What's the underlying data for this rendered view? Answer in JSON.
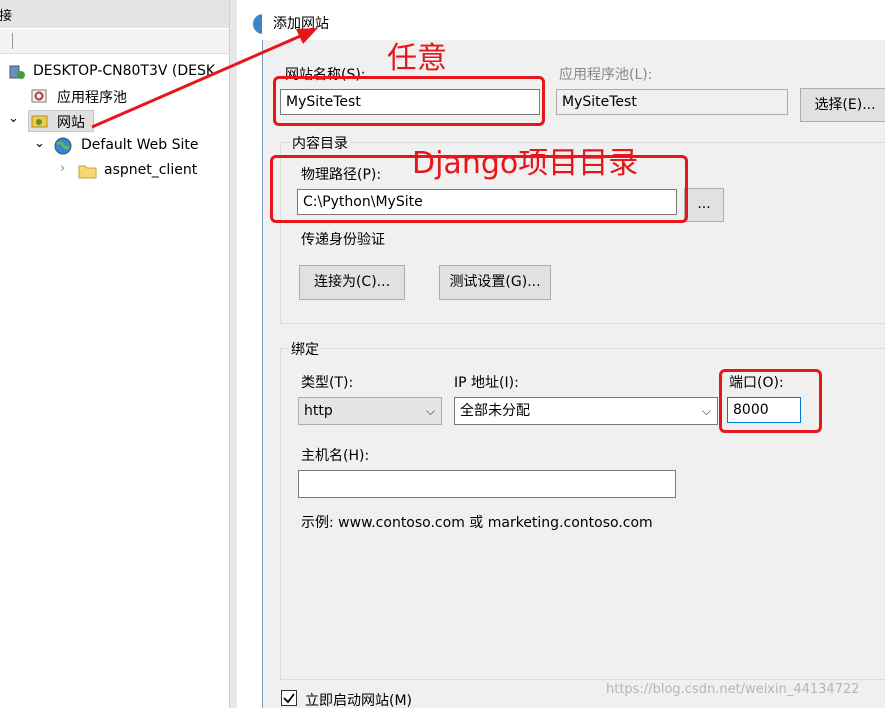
{
  "left_pane": {
    "header": "连接",
    "tree": [
      {
        "label": "DESKTOP-CN80T3V (DESK",
        "icon": "server-icon"
      },
      {
        "label": "应用程序池",
        "icon": "app-pool-icon"
      },
      {
        "label": "网站",
        "icon": "sites-folder-icon"
      },
      {
        "label": "Default Web Site",
        "icon": "globe-icon"
      },
      {
        "label": "aspnet_client",
        "icon": "folder-icon"
      }
    ]
  },
  "dialog": {
    "title": "添加网站",
    "site_name": {
      "label": "网站名称(S):",
      "value": "MySiteTest"
    },
    "app_pool": {
      "label": "应用程序池(L):",
      "value": "MySiteTest",
      "select_button": "选择(E)..."
    },
    "content_dir": {
      "group_label": "内容目录",
      "path_label": "物理路径(P):",
      "path_value": "C:\\Python\\MySite",
      "browse_button": "...",
      "auth_label": "传递身份验证",
      "connect_button": "连接为(C)...",
      "test_button": "测试设置(G)..."
    },
    "binding": {
      "group_label": "绑定",
      "type_label": "类型(T):",
      "type_value": "http",
      "ip_label": "IP 地址(I):",
      "ip_value": "全部未分配",
      "port_label": "端口(O):",
      "port_value": "8000",
      "host_label": "主机名(H):",
      "host_value": "",
      "example": "示例: www.contoso.com 或 marketing.contoso.com"
    },
    "start_immediately": {
      "label": "立即启动网站(M)",
      "checked": true
    }
  },
  "annotations": {
    "note_any": "任意",
    "note_django": "Django项目目录",
    "color": "#e8151a"
  },
  "watermark": "https://blog.csdn.net/weixin_44134722"
}
